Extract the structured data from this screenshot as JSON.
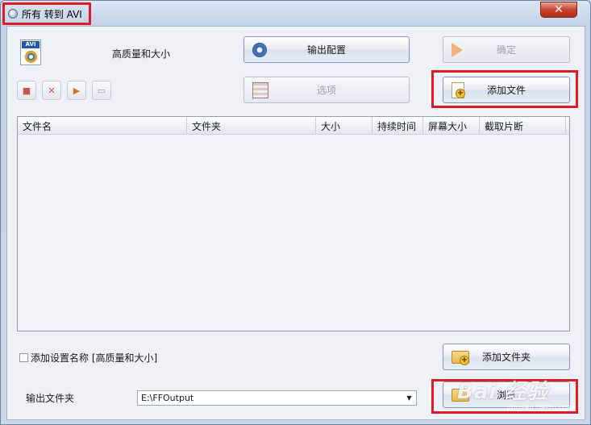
{
  "window": {
    "title": "所有 转到 AVI",
    "close_glyph": "✕"
  },
  "profile": {
    "quality_label": "高质量和大小",
    "avi_tag": "AVI"
  },
  "toolbar": {
    "output_settings_label": "输出配置",
    "ok_label": "确定",
    "options_label": "选项",
    "add_file_label": "添加文件"
  },
  "file_list": {
    "columns": [
      "文件名",
      "文件夹",
      "大小",
      "持续时间",
      "屏幕大小",
      "截取片断"
    ],
    "rows": []
  },
  "bottom": {
    "add_setting_name_label": "添加设置名称 [高质量和大小]",
    "add_folder_label": "添加文件夹",
    "output_folder_label": "输出文件夹",
    "output_folder_value": "E:\\FFOutput",
    "browse_label": "浏览"
  },
  "watermark": {
    "text": "Bai 经验",
    "sub": "jingyan.baidu.com"
  },
  "colors": {
    "highlight": "#e01b24",
    "close_button": "#c7432d"
  }
}
